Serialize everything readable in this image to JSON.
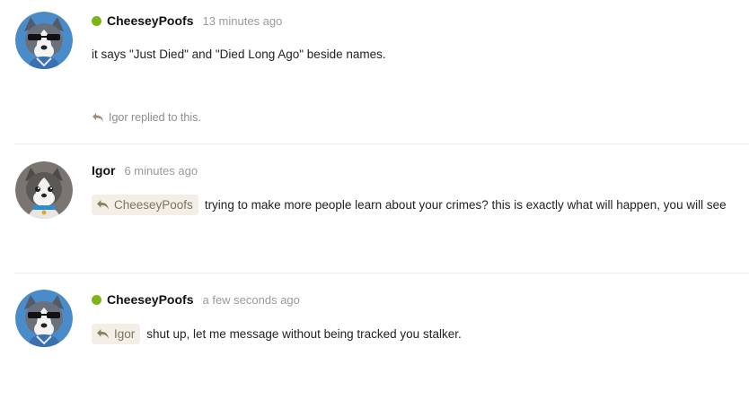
{
  "colors": {
    "online": "#7cb518",
    "mention_bg": "#f4efe6",
    "mention_text": "#7d7460",
    "timestamp": "#9a9a9a",
    "replied_note": "#8d8d8d"
  },
  "posts": [
    {
      "author": "CheeseyPoofs",
      "online": true,
      "avatar": "husky-with-sunglasses",
      "timestamp": "13 minutes ago",
      "text": "it says \"Just Died\" and \"Died Long Ago\" beside names.",
      "replied_by": "Igor replied to this."
    },
    {
      "author": "Igor",
      "online": false,
      "avatar": "husky-with-blue-collar",
      "timestamp": "6 minutes ago",
      "mention": "CheeseyPoofs",
      "text": "trying to make more people learn about your crimes? this is exactly what will happen, you will see"
    },
    {
      "author": "CheeseyPoofs",
      "online": true,
      "avatar": "husky-with-sunglasses",
      "timestamp": "a few seconds ago",
      "mention": "Igor",
      "text": "shut up, let me message without being tracked you stalker."
    }
  ]
}
